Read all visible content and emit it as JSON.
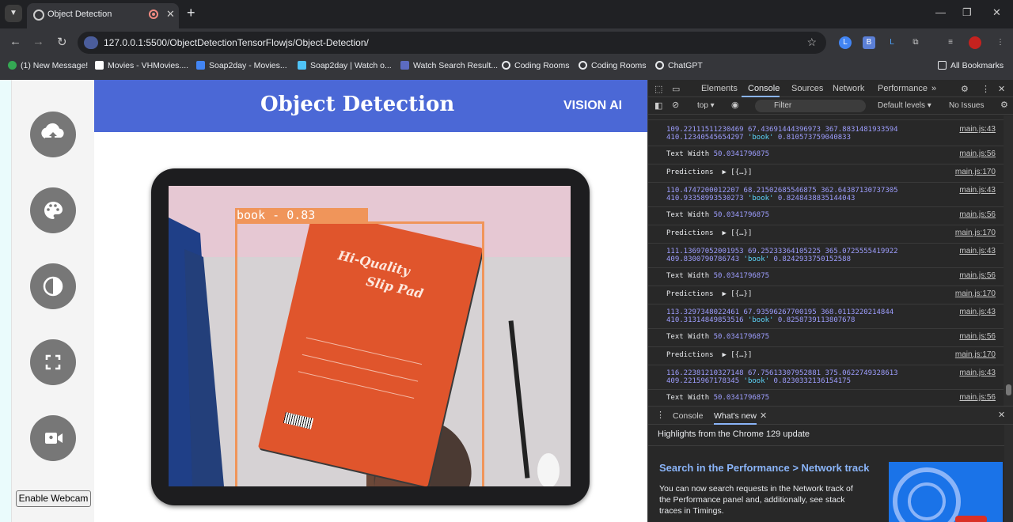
{
  "browser": {
    "tab_title": "Object Detection",
    "url": "127.0.0.1:5500/ObjectDetectionTensorFlowjs/Object-Detection/",
    "new_tab": "+",
    "bookmarks": [
      {
        "label": "(1) New Message!",
        "color": "#34a853"
      },
      {
        "label": "Movies - VHMovies....",
        "color": "#ffffff"
      },
      {
        "label": "Soap2day - Movies...",
        "color": "#4285f4"
      },
      {
        "label": "Soap2day | Watch o...",
        "color": "#4fc3f7"
      },
      {
        "label": "Watch Search Result...",
        "color": "#5c6bc0"
      },
      {
        "label": "Coding Rooms",
        "color": "#e8eaed"
      },
      {
        "label": "Coding Rooms",
        "color": "#e8eaed"
      },
      {
        "label": "ChatGPT",
        "color": "#e8eaed"
      }
    ],
    "all_bookmarks": "All Bookmarks"
  },
  "page": {
    "brand": "Object Detection",
    "vision": "VISION AI",
    "webcam_button": "Enable Webcam",
    "detection_label": "book - 0.83",
    "book_title_1": "Hi-Quality",
    "book_title_2": "Slip Pad",
    "sidebar_icons": [
      "upload-icon",
      "palette-icon",
      "contrast-icon",
      "fullscreen-icon",
      "video-icon"
    ]
  },
  "devtools": {
    "tabs": [
      "Elements",
      "Console",
      "Sources",
      "Network",
      "Performance"
    ],
    "active_tab": "Console",
    "context": "top",
    "filter_placeholder": "Filter",
    "levels": "Default levels",
    "issues": "No Issues",
    "logs": [
      {
        "kind": "pred-vals",
        "line1": "109.22111511230469 67.43691444396973 367.8831481933594",
        "line2": "410.12340545654297 ",
        "label": "'book'",
        "score": " 0.8105737590408​33",
        "src": "main.js:43"
      },
      {
        "kind": "width",
        "text": "Text Width ",
        "val": "50.0341796875",
        "src": "main.js:56"
      },
      {
        "kind": "pred",
        "text": "Predictions  ▶ [{…}]",
        "src": "main.js:170"
      },
      {
        "kind": "pred-vals",
        "line1": "110.4747200012207 68.21502685546875 362.64387130737305",
        "line2": "410.93358993530273 ",
        "label": "'book'",
        "score": " 0.8248438835144043",
        "src": "main.js:43"
      },
      {
        "kind": "width",
        "text": "Text Width ",
        "val": "50.0341796875",
        "src": "main.js:56"
      },
      {
        "kind": "pred",
        "text": "Predictions  ▶ [{…}]",
        "src": "main.js:170"
      },
      {
        "kind": "pred-vals",
        "line1": "111.13697052001953 69.25233364105225 365.0725555419922",
        "line2": "409.8300790786743 ",
        "label": "'book'",
        "score": " 0.8242933750152588",
        "src": "main.js:43"
      },
      {
        "kind": "width",
        "text": "Text Width ",
        "val": "50.0341796875",
        "src": "main.js:56"
      },
      {
        "kind": "pred",
        "text": "Predictions  ▶ [{…}]",
        "src": "main.js:170"
      },
      {
        "kind": "pred-vals",
        "line1": "113.3297348022461 67.93596267700195 368.0113220214844",
        "line2": "410.31314849853516 ",
        "label": "'book'",
        "score": " 0.8258739113807678",
        "src": "main.js:43"
      },
      {
        "kind": "width",
        "text": "Text Width ",
        "val": "50.0341796875",
        "src": "main.js:56"
      },
      {
        "kind": "pred",
        "text": "Predictions  ▶ [{…}]",
        "src": "main.js:170"
      },
      {
        "kind": "pred-vals",
        "line1": "116.22381210327148 67.75613307952881 375.0622749328613",
        "line2": "409.2215967178345 ",
        "label": "'book'",
        "score": " 0.8230332136154175",
        "src": "main.js:43"
      },
      {
        "kind": "width",
        "text": "Text Width ",
        "val": "50.0341796875",
        "src": "main.js:56"
      }
    ],
    "drawer_tabs": [
      "Console",
      "What's new"
    ],
    "highlights": "Highlights from the Chrome 129 update",
    "news_title": "Search in the Performance > Network track",
    "news_body": "You can now search requests in the Network track of the Performance panel and, additionally, see stack traces in Timings."
  }
}
